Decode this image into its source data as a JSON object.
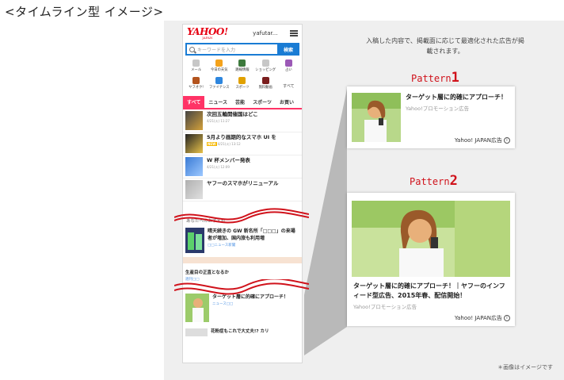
{
  "heading": "<タイムライン型 イメージ>",
  "phone": {
    "logo": "YAHOO!",
    "logo_sub": "JAPAN",
    "user": "yafutar...",
    "search_placeholder": "キーワードを入力",
    "search_button": "検索",
    "services": [
      {
        "label": "メール",
        "color": "#c7c7c7"
      },
      {
        "label": "今日の天気",
        "color": "#f4a21b"
      },
      {
        "label": "路線情報",
        "color": "#3d7a3d"
      },
      {
        "label": "ショッピング",
        "color": "#c7c7c7"
      },
      {
        "label": "占い",
        "color": "#9b59b6"
      },
      {
        "label": "ヤフオク!",
        "color": "#b3541e"
      },
      {
        "label": "ファイナンス",
        "color": "#2e86de"
      },
      {
        "label": "スポーツ",
        "color": "#e1a100"
      },
      {
        "label": "無料動画",
        "color": "#7a1e1e"
      },
      {
        "label": "すべて",
        "color": "#ffffff"
      }
    ],
    "tabs": [
      "すべて",
      "ニュース",
      "芸能",
      "スポーツ",
      "お買い"
    ],
    "news": [
      {
        "title": "次回五輪開催国はどこ",
        "meta": "4/21(火) 11:27",
        "new": false
      },
      {
        "title": "5月より画期的なスマホ UI を",
        "meta": "4/21(火) 13:12",
        "new": true,
        "new_label": "NEW"
      },
      {
        "title": "W 杯メンバー発表",
        "meta": "4/21(火) 12:09",
        "new": false
      },
      {
        "title": "ヤフーのスマホがリニューアル",
        "meta": "",
        "new": false
      }
    ],
    "recommend_label": "あなたへのおすすめ",
    "feed": [
      {
        "title": "晴天続きの GW 新名所「□□□」の来場者が増加、国内旅も利用増",
        "source": "□□ニュース新聞"
      },
      {
        "title": "生産目の正直となるか",
        "source": "週刊□□"
      },
      {
        "title": "ターゲット層に的確にアプローチ！",
        "source": "ニュース□□"
      },
      {
        "title": "花粉症もこれで大丈夫!? カリ",
        "source": ""
      }
    ]
  },
  "intro": "入稿した内容で、掲載面に応じて最適化された広告が掲載されます。",
  "pattern1": {
    "label": "Pattern",
    "num": "1",
    "title": "ターゲット層に的確にアプローチ！",
    "sponsor": "Yahoo!プロモーション広告",
    "ad_label": "Yahoo! JAPAN広告"
  },
  "pattern2": {
    "label": "Pattern",
    "num": "2",
    "title": "ターゲット層に的確にアプローチ！｜ヤフーのインフィード型広告、2015年春、配信開始！",
    "sponsor": "Yahoo!プロモーション広告",
    "ad_label": "Yahoo! JAPAN広告"
  },
  "footnote": "＊画像はイメージです",
  "colors": {
    "brand_red": "#e60012",
    "accent_blue": "#1a7cd4",
    "tab_pink": "#ff3366",
    "pattern_red": "#d0121b"
  }
}
